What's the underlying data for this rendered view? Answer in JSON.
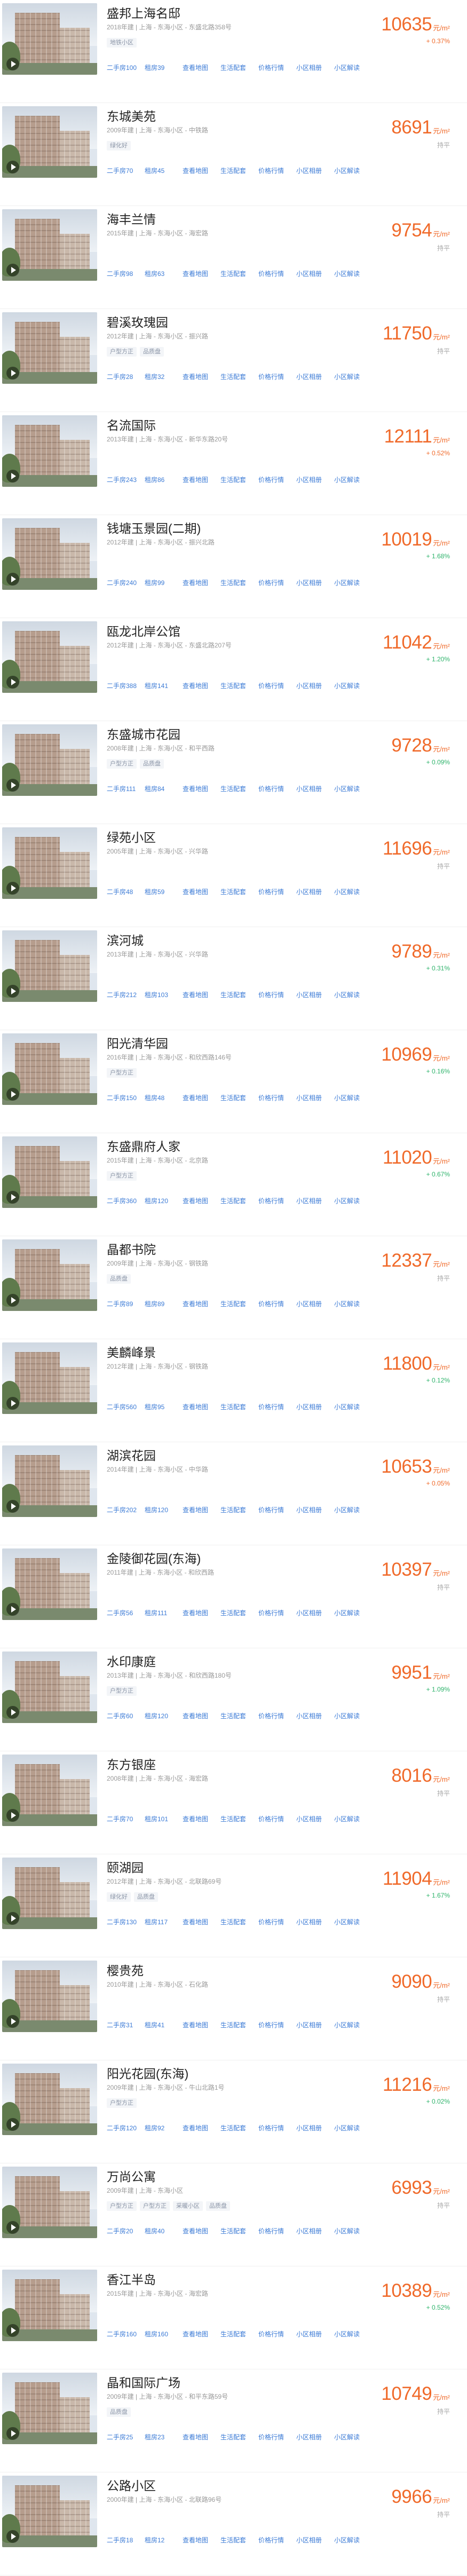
{
  "colors": {
    "accent": "#f06a2a",
    "link": "#3c7bd6",
    "down": "#2eb36b",
    "muted": "#999999"
  },
  "icons": {
    "video": "play-video-icon"
  },
  "links_labels": [
    "二手房",
    "租房",
    "查看地图",
    "生活配套",
    "价格行情",
    "小区相册",
    "小区解读"
  ],
  "price_unit": "元/m²",
  "items": [
    {
      "name": "盛邦上海名邸",
      "year": "2018年建",
      "district": "上海 - 东海小区",
      "addr": "东盛北路358号",
      "tags": [
        "地铁小区"
      ],
      "price": "10635",
      "change": "+ 0.37%",
      "dir": "up",
      "sale": "二手房100",
      "rent": "租房39"
    },
    {
      "name": "东城美苑",
      "year": "2009年建",
      "district": "上海 - 东海小区",
      "addr": "中铁路",
      "tags": [
        "绿化好"
      ],
      "price": "8691",
      "change": "持平",
      "dir": "flat",
      "sale": "二手房70",
      "rent": "租房45"
    },
    {
      "name": "海丰兰情",
      "year": "2015年建",
      "district": "上海 - 东海小区",
      "addr": "海宏路",
      "tags": [],
      "price": "9754",
      "change": "持平",
      "dir": "flat",
      "sale": "二手房98",
      "rent": "租房63"
    },
    {
      "name": "碧溪玫瑰园",
      "year": "2012年建",
      "district": "上海 - 东海小区",
      "addr": "振兴路",
      "tags": [
        "户型方正",
        "品质盘"
      ],
      "price": "11750",
      "change": "持平",
      "dir": "flat",
      "sale": "二手房28",
      "rent": "租房32"
    },
    {
      "name": "名流国际",
      "year": "2013年建",
      "district": "上海 - 东海小区",
      "addr": "新华东路20号",
      "tags": [],
      "price": "12111",
      "change": "+ 0.52%",
      "dir": "up",
      "sale": "二手房243",
      "rent": "租房86"
    },
    {
      "name": "钱塘玉景园(二期)",
      "year": "2012年建",
      "district": "上海 - 东海小区",
      "addr": "振兴北路",
      "tags": [],
      "price": "10019",
      "change": "+ 1.68%",
      "dir": "down",
      "sale": "二手房240",
      "rent": "租房99"
    },
    {
      "name": "瓯龙北岸公馆",
      "year": "2012年建",
      "district": "上海 - 东海小区",
      "addr": "东盛北路207号",
      "tags": [],
      "price": "11042",
      "change": "+ 1.20%",
      "dir": "down",
      "sale": "二手房388",
      "rent": "租房141"
    },
    {
      "name": "东盛城市花园",
      "year": "2008年建",
      "district": "上海 - 东海小区",
      "addr": "和平西路",
      "tags": [
        "户型方正",
        "品质盘"
      ],
      "price": "9728",
      "change": "+ 0.09%",
      "dir": "down",
      "sale": "二手房111",
      "rent": "租房84"
    },
    {
      "name": "绿苑小区",
      "year": "2005年建",
      "district": "上海 - 东海小区",
      "addr": "兴华路",
      "tags": [],
      "price": "11696",
      "change": "持平",
      "dir": "flat",
      "sale": "二手房48",
      "rent": "租房59"
    },
    {
      "name": "滨河城",
      "year": "2013年建",
      "district": "上海 - 东海小区",
      "addr": "兴华路",
      "tags": [],
      "price": "9789",
      "change": "+ 0.31%",
      "dir": "down",
      "sale": "二手房212",
      "rent": "租房103"
    },
    {
      "name": "阳光清华园",
      "year": "2016年建",
      "district": "上海 - 东海小区",
      "addr": "和欣西路146号",
      "tags": [
        "户型方正"
      ],
      "price": "10969",
      "change": "+ 0.16%",
      "dir": "down",
      "sale": "二手房150",
      "rent": "租房48"
    },
    {
      "name": "东盛鼎府人家",
      "year": "2015年建",
      "district": "上海 - 东海小区",
      "addr": "北京路",
      "tags": [
        "户型方正"
      ],
      "price": "11020",
      "change": "+ 0.67%",
      "dir": "down",
      "sale": "二手房360",
      "rent": "租房120"
    },
    {
      "name": "晶都书院",
      "year": "2009年建",
      "district": "上海 - 东海小区",
      "addr": "钢铁路",
      "tags": [
        "品质盘"
      ],
      "price": "12337",
      "change": "持平",
      "dir": "flat",
      "sale": "二手房89",
      "rent": "租房89"
    },
    {
      "name": "美麟峰景",
      "year": "2012年建",
      "district": "上海 - 东海小区",
      "addr": "钢铁路",
      "tags": [],
      "price": "11800",
      "change": "+ 0.12%",
      "dir": "down",
      "sale": "二手房560",
      "rent": "租房95"
    },
    {
      "name": "湖滨花园",
      "year": "2014年建",
      "district": "上海 - 东海小区",
      "addr": "中华路",
      "tags": [],
      "price": "10653",
      "change": "+ 0.05%",
      "dir": "up",
      "sale": "二手房202",
      "rent": "租房120"
    },
    {
      "name": "金陵御花园(东海)",
      "year": "2011年建",
      "district": "上海 - 东海小区",
      "addr": "和欣西路",
      "tags": [],
      "price": "10397",
      "change": "持平",
      "dir": "flat",
      "sale": "二手房56",
      "rent": "租房111"
    },
    {
      "name": "水印康庭",
      "year": "2013年建",
      "district": "上海 - 东海小区",
      "addr": "和欣西路180号",
      "tags": [
        "户型方正"
      ],
      "price": "9951",
      "change": "+ 1.09%",
      "dir": "down",
      "sale": "二手房60",
      "rent": "租房120"
    },
    {
      "name": "东方银座",
      "year": "2008年建",
      "district": "上海 - 东海小区",
      "addr": "海宏路",
      "tags": [],
      "price": "8016",
      "change": "持平",
      "dir": "flat",
      "sale": "二手房70",
      "rent": "租房101"
    },
    {
      "name": "颐湖园",
      "year": "2012年建",
      "district": "上海 - 东海小区",
      "addr": "北联路69号",
      "tags": [
        "绿化好",
        "品质盘"
      ],
      "price": "11904",
      "change": "+ 1.67%",
      "dir": "down",
      "sale": "二手房130",
      "rent": "租房117"
    },
    {
      "name": "樱贵苑",
      "year": "2010年建",
      "district": "上海 - 东海小区",
      "addr": "石化路",
      "tags": [],
      "price": "9090",
      "change": "持平",
      "dir": "flat",
      "sale": "二手房31",
      "rent": "租房41"
    },
    {
      "name": "阳光花园(东海)",
      "year": "2009年建",
      "district": "上海 - 东海小区",
      "addr": "牛山北路1号",
      "tags": [
        "户型方正"
      ],
      "price": "11216",
      "change": "+ 0.02%",
      "dir": "down",
      "sale": "二手房120",
      "rent": "租房92"
    },
    {
      "name": "万尚公寓",
      "year": "2009年建",
      "district": "上海 - 东海小区",
      "addr": "",
      "tags": [
        "户型方正",
        "户型方正",
        "采暖小区",
        "品质盘"
      ],
      "price": "6993",
      "change": "持平",
      "dir": "flat",
      "sale": "二手房20",
      "rent": "租房40"
    },
    {
      "name": "香江半岛",
      "year": "2015年建",
      "district": "上海 - 东海小区",
      "addr": "海宏路",
      "tags": [],
      "price": "10389",
      "change": "+ 0.52%",
      "dir": "down",
      "sale": "二手房160",
      "rent": "租房160"
    },
    {
      "name": "晶和国际广场",
      "year": "2009年建",
      "district": "上海 - 东海小区",
      "addr": "和平东路59号",
      "tags": [
        "品质盘"
      ],
      "price": "10749",
      "change": "持平",
      "dir": "flat",
      "sale": "二手房25",
      "rent": "租房23"
    },
    {
      "name": "公路小区",
      "year": "2000年建",
      "district": "上海 - 东海小区",
      "addr": "北联路96号",
      "tags": [],
      "price": "9966",
      "change": "持平",
      "dir": "flat",
      "sale": "二手房18",
      "rent": "租房12"
    }
  ]
}
